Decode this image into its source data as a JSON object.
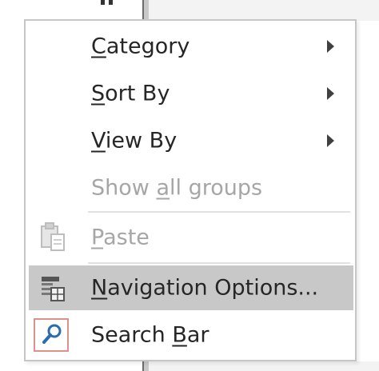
{
  "menu": {
    "items": [
      {
        "prefix": "",
        "accel": "C",
        "suffix": "ategory",
        "submenu": true,
        "enabled": true
      },
      {
        "prefix": "",
        "accel": "S",
        "suffix": "ort By",
        "submenu": true,
        "enabled": true
      },
      {
        "prefix": "",
        "accel": "V",
        "suffix": "iew By",
        "submenu": true,
        "enabled": true
      },
      {
        "prefix": "Show ",
        "accel": "a",
        "suffix": "ll groups",
        "submenu": false,
        "enabled": false
      },
      {
        "prefix": "",
        "accel": "P",
        "suffix": "aste",
        "submenu": false,
        "enabled": false,
        "icon": "clipboard-paste-icon"
      },
      {
        "prefix": "",
        "accel": "N",
        "suffix": "avigation Options...",
        "submenu": false,
        "enabled": true,
        "icon": "navigation-options-icon",
        "highlighted": true
      },
      {
        "prefix": "Search ",
        "accel": "B",
        "suffix": "ar",
        "submenu": false,
        "enabled": true,
        "icon": "search-icon"
      }
    ]
  },
  "colors": {
    "highlight": "#c8c8c8",
    "disabled_text": "#a6a6a6",
    "text": "#262626",
    "search_icon_blue": "#2b6cb0",
    "search_box_border": "#e08f8f"
  }
}
